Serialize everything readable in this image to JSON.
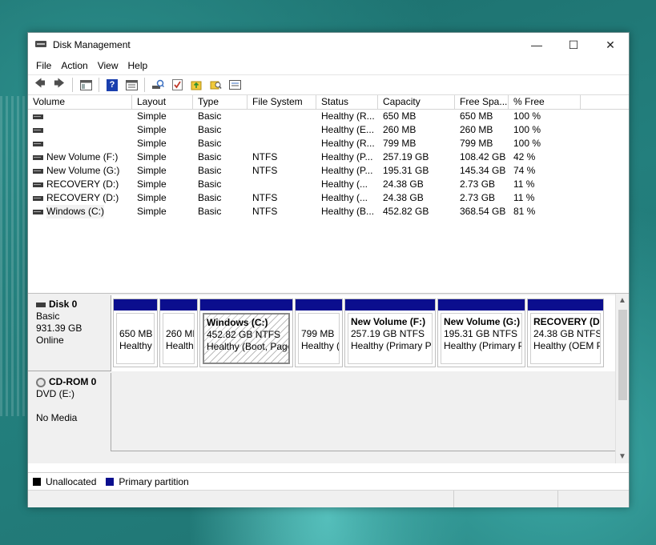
{
  "window": {
    "title": "Disk Management"
  },
  "controls": {
    "minimize": "—",
    "maximize": "☐",
    "close": "✕"
  },
  "menu": [
    "File",
    "Action",
    "View",
    "Help"
  ],
  "toolbar": {
    "back": "🡄",
    "forward": "🡆",
    "help": "?",
    "folder": "▮",
    "check": "✓"
  },
  "volume_table": {
    "headers": [
      "Volume",
      "Layout",
      "Type",
      "File System",
      "Status",
      "Capacity",
      "Free Spa...",
      "% Free"
    ],
    "rows": [
      {
        "volume": "",
        "layout": "Simple",
        "type": "Basic",
        "fs": "",
        "status": "Healthy (R...",
        "capacity": "650 MB",
        "free": "650 MB",
        "pct": "100 %"
      },
      {
        "volume": "",
        "layout": "Simple",
        "type": "Basic",
        "fs": "",
        "status": "Healthy (E...",
        "capacity": "260 MB",
        "free": "260 MB",
        "pct": "100 %"
      },
      {
        "volume": "",
        "layout": "Simple",
        "type": "Basic",
        "fs": "",
        "status": "Healthy (R...",
        "capacity": "799 MB",
        "free": "799 MB",
        "pct": "100 %"
      },
      {
        "volume": "New Volume (F:)",
        "layout": "Simple",
        "type": "Basic",
        "fs": "NTFS",
        "status": "Healthy (P...",
        "capacity": "257.19 GB",
        "free": "108.42 GB",
        "pct": "42 %"
      },
      {
        "volume": "New Volume (G:)",
        "layout": "Simple",
        "type": "Basic",
        "fs": "NTFS",
        "status": "Healthy (P...",
        "capacity": "195.31 GB",
        "free": "145.34 GB",
        "pct": "74 %"
      },
      {
        "volume": "RECOVERY (D:)",
        "layout": "Simple",
        "type": "Basic",
        "fs": "",
        "status": "Healthy (...",
        "capacity": "24.38 GB",
        "free": "2.73 GB",
        "pct": "11 %"
      },
      {
        "volume": "RECOVERY (D:)",
        "layout": "Simple",
        "type": "Basic",
        "fs": "NTFS",
        "status": "Healthy (...",
        "capacity": "24.38 GB",
        "free": "2.73 GB",
        "pct": "11 %"
      },
      {
        "volume": "Windows (C:)",
        "layout": "Simple",
        "type": "Basic",
        "fs": "NTFS",
        "status": "Healthy (B...",
        "capacity": "452.82 GB",
        "free": "368.54 GB",
        "pct": "81 %"
      }
    ]
  },
  "disk0": {
    "name": "Disk 0",
    "type": "Basic",
    "size": "931.39 GB",
    "state": "Online",
    "partitions": [
      {
        "name": "",
        "size": "650 MB",
        "status": "Healthy"
      },
      {
        "name": "",
        "size": "260 ME",
        "status": "Health"
      },
      {
        "name": "Windows  (C:)",
        "size": "452.82 GB NTFS",
        "status": "Healthy (Boot, Page"
      },
      {
        "name": "",
        "size": "799 MB",
        "status": "Healthy ("
      },
      {
        "name": "New Volume  (F:)",
        "size": "257.19 GB NTFS",
        "status": "Healthy (Primary Pa"
      },
      {
        "name": "New Volume  (G:)",
        "size": "195.31 GB NTFS",
        "status": "Healthy (Primary P"
      },
      {
        "name": "RECOVERY  (D:",
        "size": "24.38 GB NTFS",
        "status": "Healthy (OEM P"
      }
    ]
  },
  "cdrom0": {
    "name": "CD-ROM 0",
    "type": "DVD (E:)",
    "media": "No Media"
  },
  "legend": {
    "unallocated": "Unallocated",
    "primary": "Primary partition"
  },
  "colors": {
    "primary_partition": "#0b0e8e",
    "unallocated": "#000000"
  }
}
